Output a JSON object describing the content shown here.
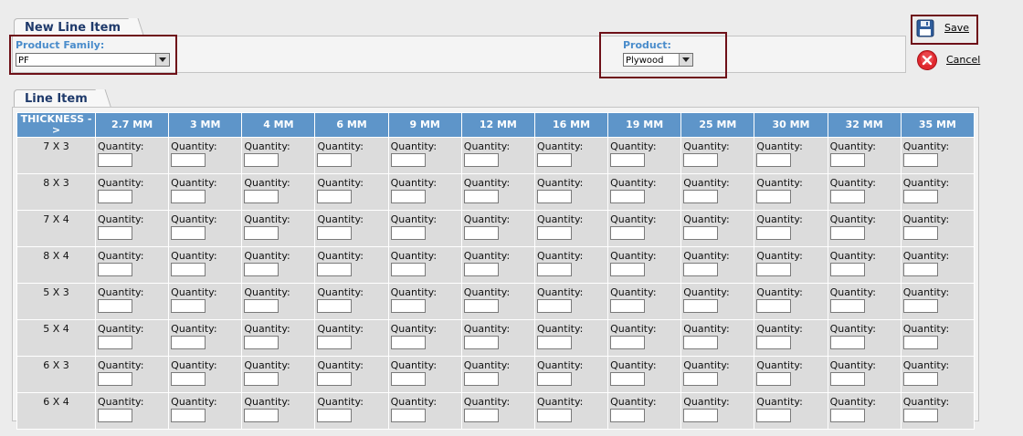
{
  "new_line_item": {
    "tab_label": "New Line Item",
    "product_family_label": "Product Family:",
    "product_family_value": "PF",
    "product_label": "Product:",
    "product_value": "Plywood"
  },
  "actions": {
    "save_label": "Save",
    "cancel_label": "Cancel"
  },
  "line_item": {
    "tab_label": "Line Item",
    "corner_header": "THICKNESS - >",
    "columns": [
      "2.7 MM",
      "3 MM",
      "4 MM",
      "6 MM",
      "9 MM",
      "12 MM",
      "16 MM",
      "19 MM",
      "25 MM",
      "30 MM",
      "32 MM",
      "35 MM"
    ],
    "rows": [
      "7 X 3",
      "8 X 3",
      "7 X 4",
      "8 X 4",
      "5 X 3",
      "5 X 4",
      "6 X 3",
      "6 X 4"
    ],
    "cell_label": "Quantity:"
  },
  "colors": {
    "header_bg": "#5e95c9",
    "cell_bg": "#dcdcdc",
    "highlight": "#6e1018",
    "label_blue": "#4a8ccb",
    "tab_text": "#1f3a6b"
  },
  "icons": {
    "save": "floppy-disk-icon",
    "cancel": "cancel-x-icon"
  }
}
